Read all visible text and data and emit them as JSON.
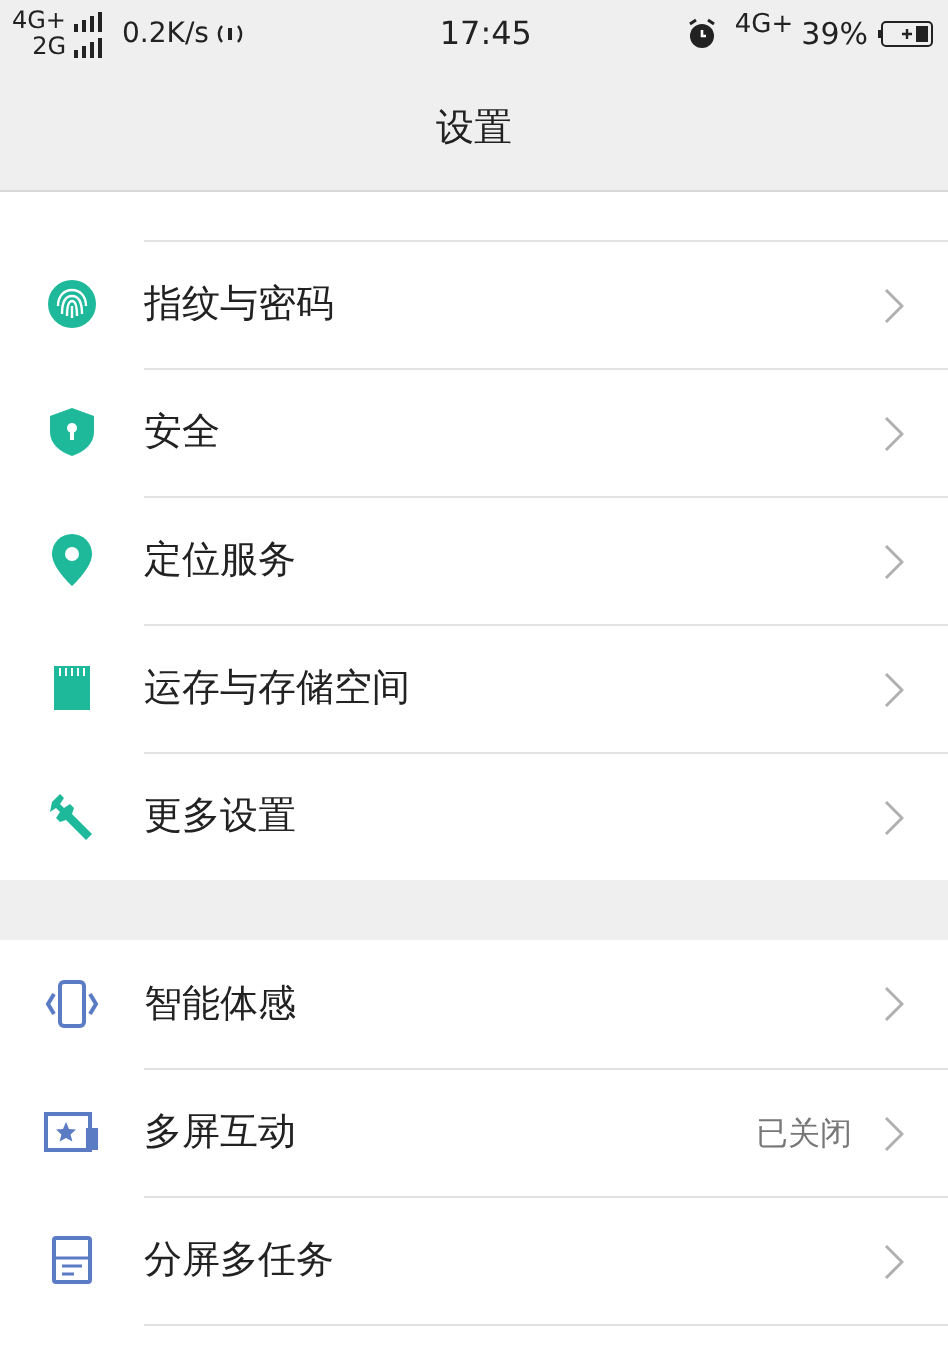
{
  "status_bar": {
    "network_top": "4G+",
    "network_bottom": "2G",
    "speed": "0.2K/s",
    "time": "17:45",
    "network_right": "4G+",
    "battery": "39%"
  },
  "header": {
    "title": "设置"
  },
  "groups": [
    {
      "color": "#1db99a",
      "items": [
        {
          "kind": "fingerprint",
          "label": "指纹与密码"
        },
        {
          "kind": "shield",
          "label": "安全"
        },
        {
          "kind": "pin",
          "label": "定位服务"
        },
        {
          "kind": "card",
          "label": "运存与存储空间"
        },
        {
          "kind": "wrench",
          "label": "更多设置"
        }
      ]
    },
    {
      "color": "#5b7cc4",
      "items": [
        {
          "kind": "phone",
          "label": "智能体感"
        },
        {
          "kind": "screen",
          "label": "多屏互动",
          "value": "已关闭"
        },
        {
          "kind": "split",
          "label": "分屏多任务"
        }
      ]
    }
  ]
}
